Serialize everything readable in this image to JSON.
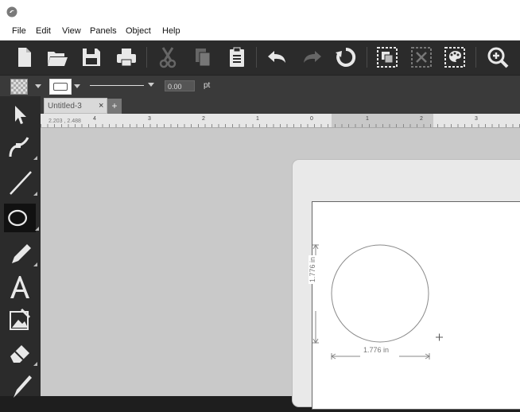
{
  "menu": [
    "File",
    "Edit",
    "View",
    "Panels",
    "Object",
    "Help"
  ],
  "toolbar": {
    "buttons": [
      "new-file-icon",
      "open-folder-icon",
      "save-icon",
      "print-icon",
      "cut-icon",
      "copy-icon",
      "paste-icon",
      "undo-icon",
      "redo-icon",
      "refresh-icon",
      "group-icon",
      "ungroup-icon",
      "palette-icon",
      "zoom-in-icon"
    ]
  },
  "properties": {
    "stroke_width": "0.00",
    "unit": "pt"
  },
  "tools": [
    "select-tool-icon",
    "node-edit-tool-icon",
    "line-tool-icon",
    "ellipse-tool-icon",
    "pencil-tool-icon",
    "text-tool-icon",
    "image-trace-tool-icon",
    "eraser-tool-icon",
    "knife-tool-icon"
  ],
  "active_tool": "ellipse-tool-icon",
  "tab": {
    "title": "Untitled-3",
    "close": "×",
    "new_tab": "+"
  },
  "ruler": {
    "coords": "2.203 , 2.488",
    "labels": [
      "4",
      "3",
      "2",
      "1",
      "0",
      "1",
      "2",
      "3"
    ]
  },
  "shape": {
    "type": "circle",
    "width_label": "1.776 in",
    "height_label": "1.776 in"
  },
  "colors": {
    "accent_bg": "#2b2b2b",
    "canvas": "#c9c9c9",
    "page": "#ffffff"
  }
}
